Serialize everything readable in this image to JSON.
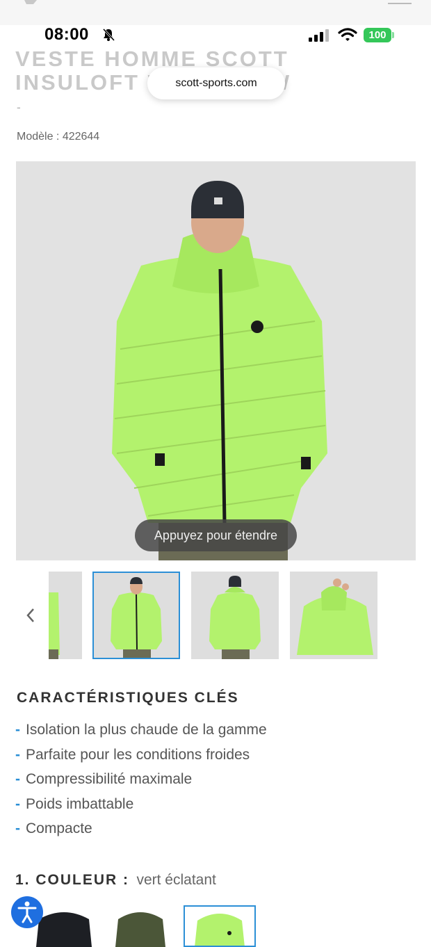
{
  "status_bar": {
    "time": "08:00",
    "battery": "100"
  },
  "browser": {
    "url": "scott-sports.com"
  },
  "product": {
    "title": "VESTE HOMME SCOTT INSULOFT WARM DOW",
    "dash": "-",
    "model": "Modèle : 422644"
  },
  "gallery": {
    "overlay_hint": "Appuyez pour étendre",
    "jacket_color": "#b3f26d"
  },
  "key_features": {
    "title": "CARACTÉRISTIQUES CLÉS",
    "items": [
      "Isolation la plus chaude de la gamme",
      "Parfaite pour les conditions froides",
      "Compressibilité maximale",
      "Poids imbattable",
      "Compacte"
    ]
  },
  "color": {
    "label": "1. COULEUR :",
    "value": "vert éclatant",
    "options": [
      "black",
      "olive",
      "green"
    ]
  },
  "colors": {
    "accent": "#2b8fd6",
    "accessibility": "#1f6fe0",
    "battery": "#34c759"
  }
}
